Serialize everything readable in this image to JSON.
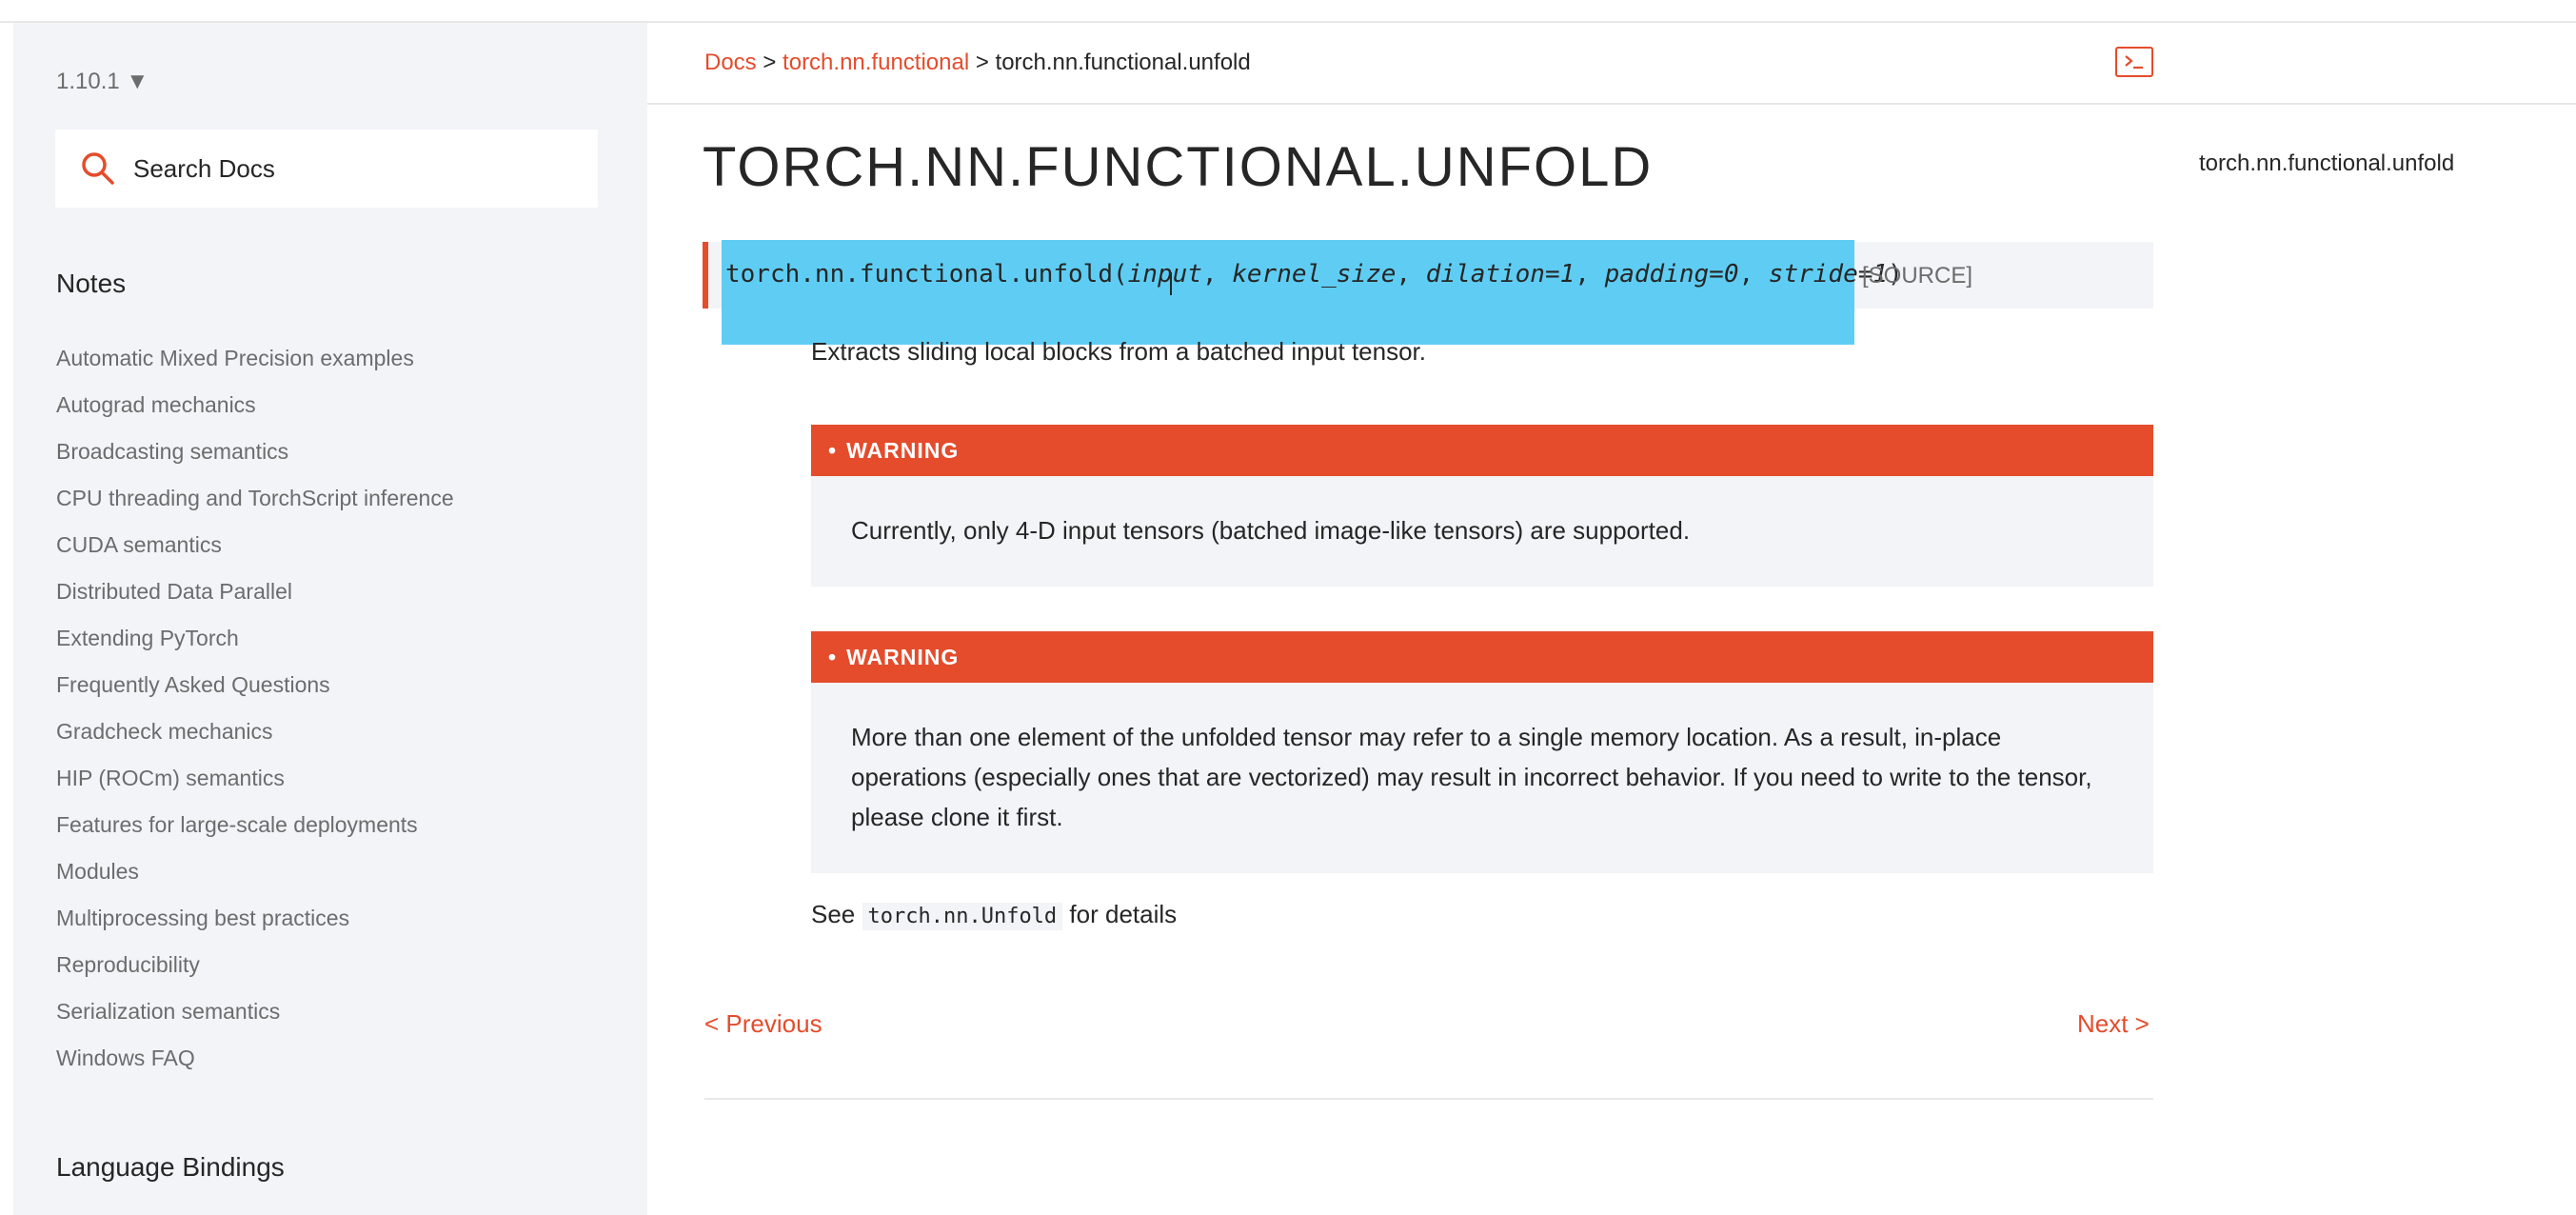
{
  "sidebar": {
    "version": "1.10.1 ▼",
    "search_placeholder": "Search Docs",
    "notes_heading": "Notes",
    "items": [
      "Automatic Mixed Precision examples",
      "Autograd mechanics",
      "Broadcasting semantics",
      "CPU threading and TorchScript inference",
      "CUDA semantics",
      "Distributed Data Parallel",
      "Extending PyTorch",
      "Frequently Asked Questions",
      "Gradcheck mechanics",
      "HIP (ROCm) semantics",
      "Features for large-scale deployments",
      "Modules",
      "Multiprocessing best practices",
      "Reproducibility",
      "Serialization semantics",
      "Windows FAQ"
    ],
    "bindings_heading": "Language Bindings"
  },
  "breadcrumb": {
    "docs": "Docs",
    "sep1": ">",
    "functional": "torch.nn.functional",
    "sep2": ">",
    "current": "torch.nn.functional.unfold"
  },
  "page": {
    "title": "TORCH.NN.FUNCTIONAL.UNFOLD",
    "toc_item": "torch.nn.functional.unfold",
    "signature": {
      "name": "torch.nn.functional.unfold(",
      "p_input": "input",
      "c1": ", ",
      "p_kernel": "kernel_size",
      "c2": ", ",
      "p_dilation": "dilation=1",
      "c3": ", ",
      "p_padding": "padding=0",
      "c4": ", ",
      "p_stride": "stride=1",
      "close": ")"
    },
    "source_label": "[SOURCE]",
    "description": "Extracts sliding local blocks from a batched input tensor.",
    "warnings": [
      {
        "title": "WARNING",
        "body": "Currently, only 4-D input tensors (batched image-like tensors) are supported."
      },
      {
        "title": "WARNING",
        "body": "More than one element of the unfolded tensor may refer to a single memory location. As a result, in-place operations (especially ones that are vectorized) may result in incorrect behavior. If you need to write to the tensor, please clone it first."
      }
    ],
    "see": {
      "prefix": "See",
      "code": "torch.nn.Unfold",
      "suffix": "for details"
    },
    "prev_label": "< Previous",
    "next_label": "Next >"
  },
  "colors": {
    "accent": "#e44c2c",
    "sidebar_bg": "#f3f4f7",
    "selection": "#5fcdf3"
  },
  "icons": {
    "search": "search-icon",
    "terminal": "terminal-icon"
  }
}
